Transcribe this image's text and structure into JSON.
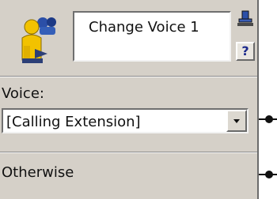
{
  "node": {
    "title": "Change Voice 1",
    "help_label": "?"
  },
  "voice": {
    "label": "Voice:",
    "selected": "[Calling Extension]"
  },
  "otherwise": {
    "label": "Otherwise"
  },
  "icons": {
    "app": "voice-person-icon",
    "pin": "pin-icon",
    "dropdown": "chevron-down-icon"
  },
  "colors": {
    "panel_bg": "#d5d0c8",
    "help_text": "#1c2a8c",
    "icon_yellow": "#f2c200",
    "icon_blue": "#2b4fa8"
  }
}
